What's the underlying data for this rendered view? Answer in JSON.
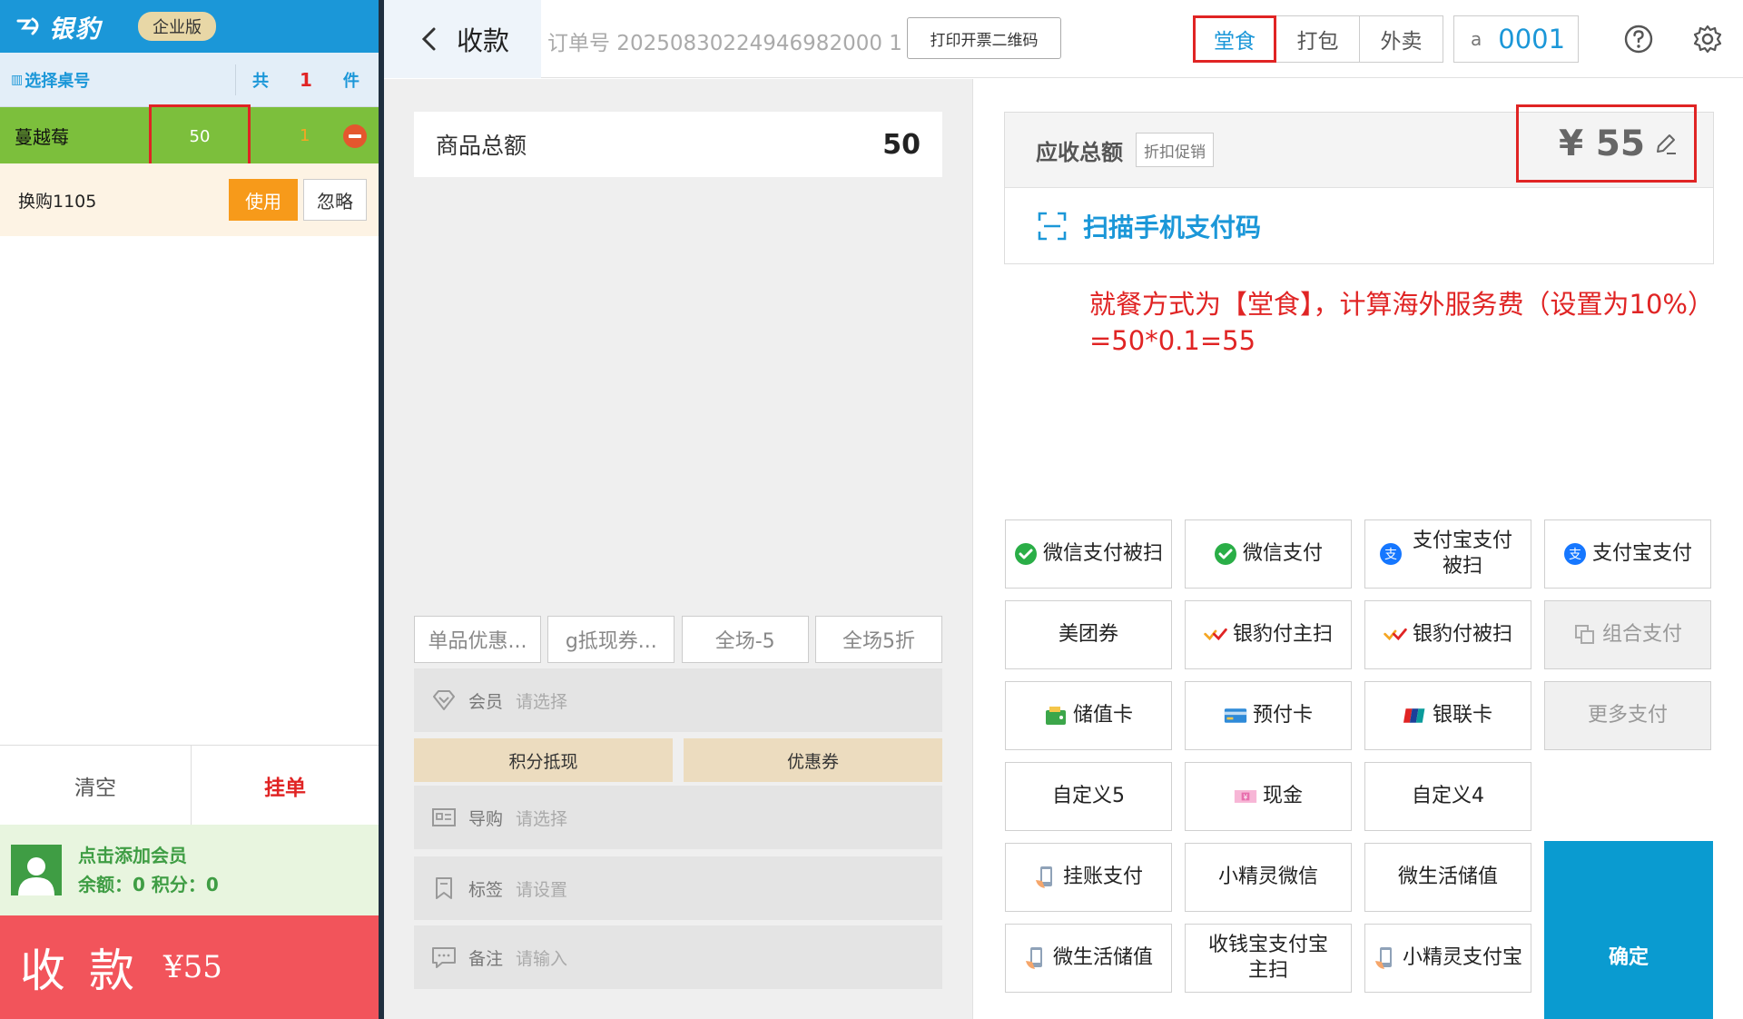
{
  "app": {
    "logo_text": "银豹",
    "edition": "企业版"
  },
  "left_panel": {
    "select_table_label": "选择桌号",
    "count_label": "共",
    "count_value": "1",
    "count_unit": "件",
    "cart_items": [
      {
        "name": "蔓越莓",
        "price": "50",
        "qty": "1"
      }
    ],
    "promotion": {
      "name": "换购1105",
      "use_label": "使用",
      "ignore_label": "忽略"
    },
    "clear_label": "清空",
    "hold_label": "挂单",
    "member": {
      "add_label": "点击添加会员",
      "balance_line": "余额：0  积分：0"
    },
    "pay_label": "收款",
    "pay_amount": "¥55"
  },
  "modal": {
    "title": "收款",
    "order_no": "订单号 20250830224946982000 1",
    "print_label": "打印开票二维码",
    "dine_modes": [
      "堂食",
      "打包",
      "外卖"
    ],
    "active_mode": "堂食",
    "table_prefix": "a",
    "table_no": "0001"
  },
  "middle": {
    "goods_total_label": "商品总额",
    "goods_total_value": "50",
    "discount_buttons": [
      "单品优惠...",
      "g抵现券...",
      "全场-5",
      "全场5折"
    ],
    "member_label": "会员",
    "member_placeholder": "请选择",
    "points_label": "积分抵现",
    "coupon_label": "优惠券",
    "guide_label": "导购",
    "guide_placeholder": "请选择",
    "tag_label": "标签",
    "tag_placeholder": "请设置",
    "note_label": "备注",
    "note_placeholder": "请输入"
  },
  "right": {
    "receivable_label": "应收总额",
    "promo_label": "折扣促销",
    "amount": "¥ 55",
    "scan_label": "扫描手机支付码",
    "annotation": "就餐方式为【堂食】，计算海外服务费（设置为10%）=50*0.1=55",
    "payment_methods": [
      {
        "label": "微信支付被扫",
        "icon": "wechat-pay-icon"
      },
      {
        "label": "微信支付",
        "icon": "wechat-pay-icon"
      },
      {
        "label": "支付宝支付被扫",
        "icon": "alipay-icon"
      },
      {
        "label": "支付宝支付",
        "icon": "alipay-icon"
      },
      {
        "label": "美团券",
        "icon": ""
      },
      {
        "label": "银豹付主扫",
        "icon": "yinbao-pay-icon"
      },
      {
        "label": "银豹付被扫",
        "icon": "yinbao-pay-icon"
      },
      {
        "label": "组合支付",
        "icon": "combo-pay-icon"
      },
      {
        "label": "储值卡",
        "icon": "wallet-icon"
      },
      {
        "label": "预付卡",
        "icon": "prepaid-card-icon"
      },
      {
        "label": "银联卡",
        "icon": "unionpay-icon"
      },
      {
        "label": "更多支付",
        "icon": ""
      },
      {
        "label": "自定义5",
        "icon": ""
      },
      {
        "label": "现金",
        "icon": "cash-icon"
      },
      {
        "label": "自定义4",
        "icon": ""
      },
      {
        "label": "挂账支付",
        "icon": "phone-pay-icon"
      },
      {
        "label": "小精灵微信",
        "icon": ""
      },
      {
        "label": "微生活储值",
        "icon": ""
      },
      {
        "label": "微生活储值",
        "icon": "phone-pay-icon"
      },
      {
        "label": "收钱宝支付宝主扫",
        "icon": ""
      },
      {
        "label": "小精灵支付宝",
        "icon": "phone-pay-icon"
      }
    ],
    "confirm_label": "确定"
  },
  "colors": {
    "brand_blue": "#1b97d8",
    "highlight_red": "#e02424",
    "item_green": "#7cbf3c",
    "pay_red": "#f2545b",
    "confirm_blue": "#0a9bd0"
  }
}
